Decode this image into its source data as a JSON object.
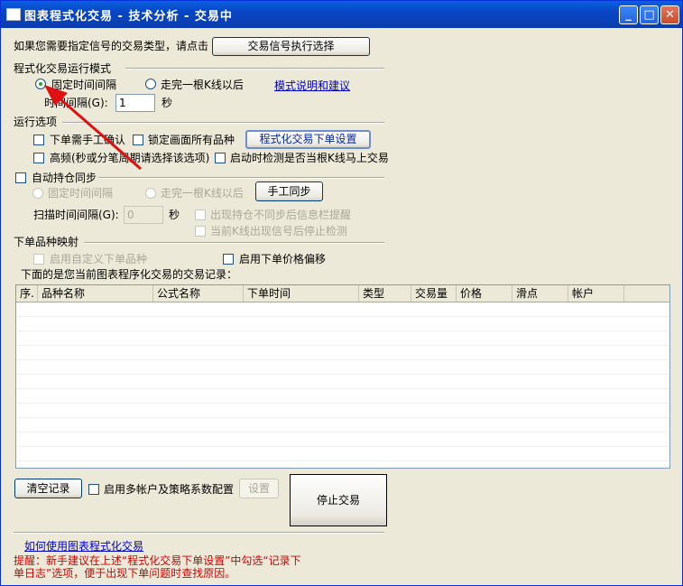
{
  "window": {
    "title": "图表程式化交易 - 技术分析 - 交易中",
    "min_glyph": "_",
    "max_glyph": "□",
    "close_glyph": "✕"
  },
  "signal": {
    "prompt": "如果您需要指定信号的交易类型，请点击",
    "button": "交易信号执行选择"
  },
  "mode": {
    "section": "程式化交易运行模式",
    "fixed_interval": "固定时间间隔",
    "after_bar": "走完一根K线以后",
    "help_link": "模式说明和建议",
    "interval_label": "时间间隔(G):",
    "interval_value": "1",
    "interval_unit": "秒"
  },
  "options": {
    "section": "运行选项",
    "manual_confirm": "下单需手工确认",
    "lock_all": "锁定画面所有品种",
    "order_settings_button": "程式化交易下单设置",
    "high_freq": "高频(秒或分笔周期请选择该选项)",
    "startup_check": "启动时检测是否当根K线马上交易"
  },
  "sync": {
    "section": "自动持仓同步",
    "fixed_interval": "固定时间间隔",
    "after_bar": "走完一根K线以后",
    "manual_sync_button": "手工同步",
    "scan_label": "扫描时间间隔(G):",
    "scan_value": "0",
    "scan_unit": "秒",
    "alert_mismatch": "出现持仓不同步后信息栏提醒",
    "stop_on_signal": "当前K线出现信号后停止检测"
  },
  "mapping": {
    "section": "下单品种映射",
    "custom_symbol": "启用自定义下单品种",
    "price_offset": "启用下单价格偏移"
  },
  "records": {
    "caption": "下面的是您当前图表程序化交易的交易记录：",
    "columns": [
      "序.",
      "品种名称",
      "公式名称",
      "下单时间",
      "类型",
      "交易量",
      "价格",
      "滑点",
      "帐户"
    ]
  },
  "bottom": {
    "clear_button": "清空记录",
    "multi_account": "启用多帐户及策略系数配置",
    "settings_button": "设置",
    "stop_button": "停止交易",
    "howto_link": "如何使用图表程式化交易",
    "warning": "提醒：新手建议在上述“程式化交易下单设置”中勾选“记录下单日志”选项，便于出现下单问题时查找原因。"
  },
  "colors": {
    "titlebar": "#0a5fe0",
    "link": "#0000cc",
    "warning": "#d40000",
    "arrow": "#e01010"
  }
}
